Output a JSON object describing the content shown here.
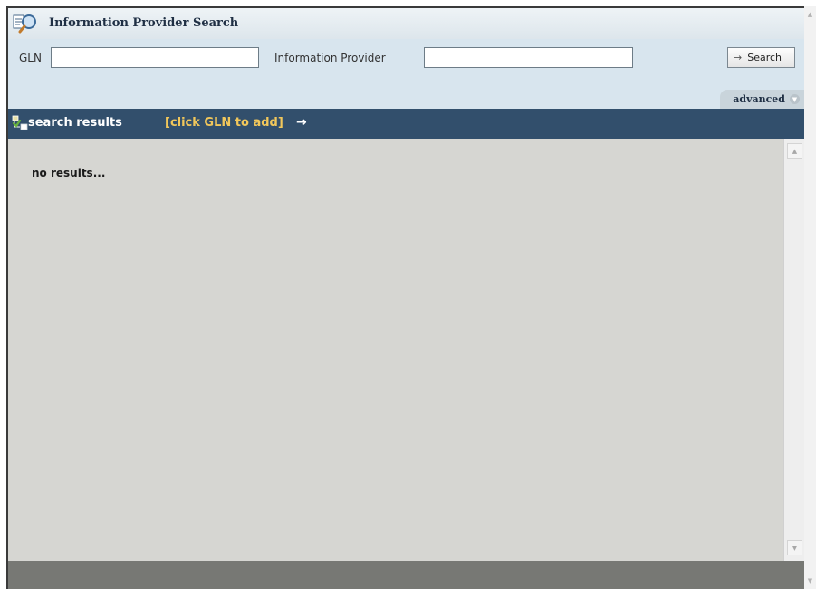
{
  "window": {
    "title": "Information Provider Search"
  },
  "search": {
    "gln_label": "GLN",
    "gln_value": "",
    "provider_label": "Information Provider",
    "provider_value": "",
    "button_label": "Search",
    "advanced_label": "advanced"
  },
  "results": {
    "title": "search results",
    "hint": "[click GLN to add]",
    "empty_message": "no results..."
  },
  "icons": {
    "title": "search-magnifier-icon",
    "search_button": "arrow-right-icon",
    "advanced": "chevron-down-icon",
    "results": "results-tree-icon",
    "results_arrow": "arrow-right-icon"
  },
  "colors": {
    "header_bg": "#324f6c",
    "hint_text": "#f1c75b",
    "form_bg": "#d8e5ee",
    "results_bg": "#d6d6d2"
  }
}
